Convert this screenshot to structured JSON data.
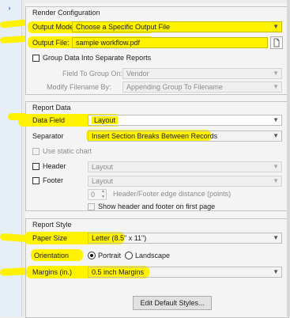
{
  "sidebar": {
    "chevrons": [
      "›",
      "›",
      "›"
    ]
  },
  "render": {
    "title": "Render Configuration",
    "output_mode_label": "Output Mode:",
    "output_mode_value": "Choose a Specific Output File",
    "output_file_label": "Output File:",
    "output_file_value": "sample workflow.pdf",
    "group_label": "Group Data Into Separate Reports",
    "field_to_group_label": "Field To Group On:",
    "field_to_group_value": "Vendor",
    "modify_filename_label": "Modify Filename By:",
    "modify_filename_value": "Appending Group To Filename"
  },
  "report_data": {
    "title": "Report Data",
    "data_field_label": "Data Field",
    "data_field_value": "Layout",
    "separator_label": "Separator",
    "separator_value": "Insert Section Breaks Between Records",
    "static_chart_label": "Use static chart",
    "header_label": "Header",
    "header_value": "Layout",
    "footer_label": "Footer",
    "footer_value": "Layout",
    "edge_distance_value": "0",
    "edge_distance_label": "Header/Footer edge distance (points)",
    "show_hf_first_label": "Show header and footer on first page"
  },
  "report_style": {
    "title": "Report Style",
    "paper_size_label": "Paper Size",
    "paper_size_value": "Letter (8.5\" x 11\")",
    "orientation_label": "Orientation",
    "portrait_label": "Portrait",
    "landscape_label": "Landscape",
    "margins_label": "Margins (in.)",
    "margins_value": "0.5 inch Margins",
    "edit_styles_button": "Edit Default Styles..."
  },
  "colors": {
    "highlight": "#fff200",
    "sidebar_chevron": "#2a6fc9"
  }
}
